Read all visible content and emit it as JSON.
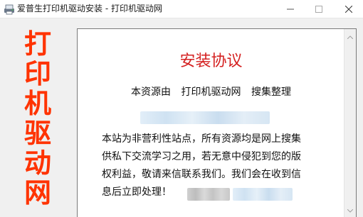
{
  "window": {
    "title": "爱普生打印机驱动安装 - 打印机驱动网",
    "app_icon": "printer-installer-icon",
    "minimize_icon": "minimize-icon",
    "maximize_icon": "maximize-icon",
    "close_icon": "close-icon"
  },
  "banner": {
    "chars": [
      "打",
      "印",
      "机",
      "驱",
      "动",
      "网"
    ],
    "color": "#ff3300"
  },
  "agreement": {
    "title": "安装协议",
    "title_color": "#d42020",
    "source_prefix": "本资源由",
    "source_name": "打印机驱动网",
    "source_suffix": "搜集整理",
    "notice_lines": [
      "本站为非营利性站点，所有资源均是网上搜集",
      "供私下交流学习之用，若无意中侵犯到您的版",
      "权利益，敬请来信联系我们。我们会在收到信",
      "息后立即处理！"
    ]
  },
  "scrollbar": {
    "up_icon": "scroll-up-arrow-icon",
    "down_icon": "scroll-down-arrow-icon"
  }
}
